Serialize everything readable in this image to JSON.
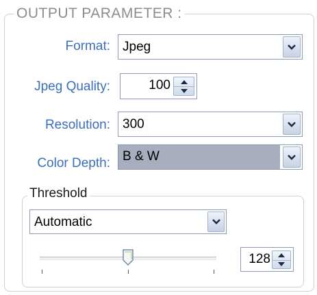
{
  "group_title": "OUTPUT PARAMETER :",
  "format": {
    "label": "Format:",
    "value": "Jpeg"
  },
  "jpeg_quality": {
    "label": "Jpeg Quality:",
    "value": "100"
  },
  "resolution": {
    "label": "Resolution:",
    "value": "300"
  },
  "color_depth": {
    "label": "Color Depth:",
    "value": "B & W"
  },
  "threshold": {
    "title": "Threshold",
    "mode": "Automatic",
    "value": "128",
    "slider_fraction": 0.5
  },
  "colors": {
    "label_blue": "#3a6ebb",
    "selected_bg": "#a8aebd"
  },
  "icons": {
    "dropdown": "chevron-down-icon",
    "spin_up": "arrow-up-icon",
    "spin_down": "arrow-down-icon"
  }
}
